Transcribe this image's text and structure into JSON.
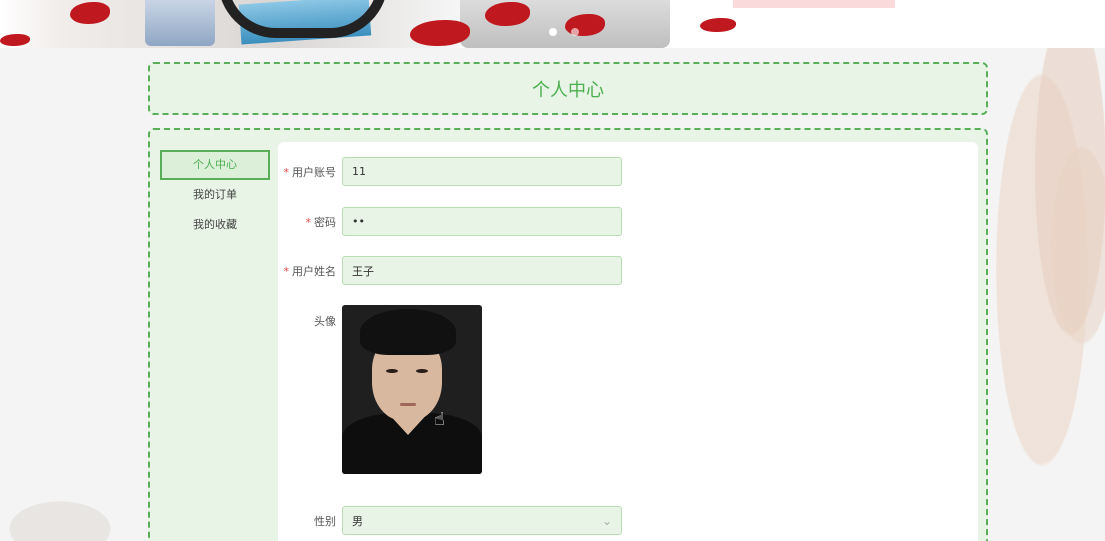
{
  "page": {
    "title": "个人中心"
  },
  "banner": {
    "carousel_dots": 2,
    "active_dot": 0
  },
  "sidebar": {
    "items": [
      {
        "label": "个人中心",
        "active": true
      },
      {
        "label": "我的订单",
        "active": false
      },
      {
        "label": "我的收藏",
        "active": false
      }
    ]
  },
  "form": {
    "account": {
      "label": "用户账号",
      "required": true,
      "value": "11"
    },
    "password": {
      "label": "密码",
      "required": true,
      "value": "••"
    },
    "name": {
      "label": "用户姓名",
      "required": true,
      "value": "王子"
    },
    "avatar": {
      "label": "头像"
    },
    "gender": {
      "label": "性别",
      "value": "男"
    }
  },
  "colors": {
    "accent": "#4caf50",
    "panel_bg": "#e8f4e6",
    "required": "#e04848"
  }
}
